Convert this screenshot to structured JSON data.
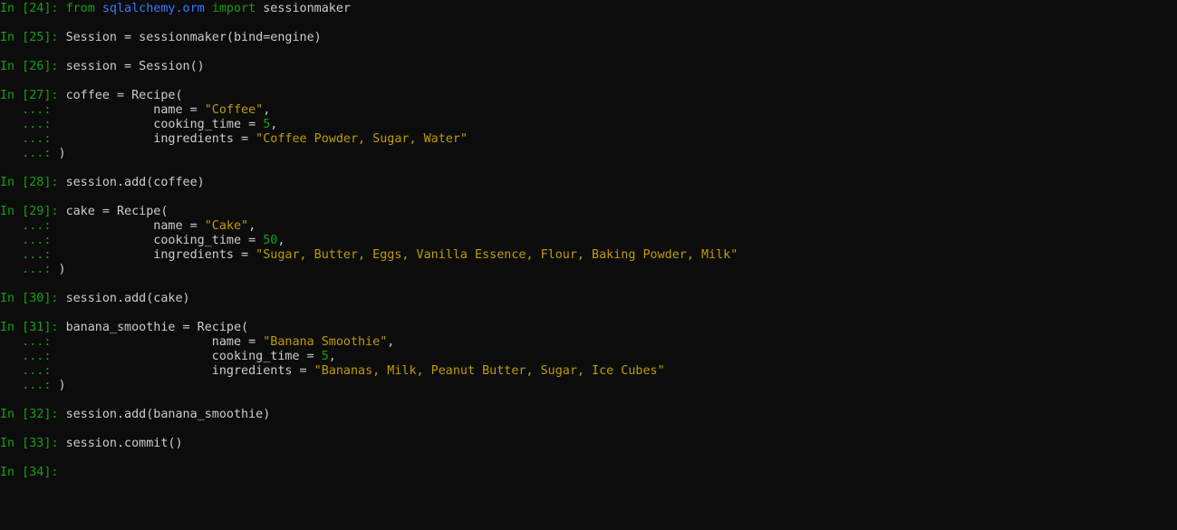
{
  "cells": [
    {
      "prompt": "In [24]: ",
      "lines": [
        [
          {
            "t": "kw",
            "v": "from"
          },
          {
            "t": "txt",
            "v": " "
          },
          {
            "t": "mod",
            "v": "sqlalchemy.orm"
          },
          {
            "t": "txt",
            "v": " "
          },
          {
            "t": "kw",
            "v": "import"
          },
          {
            "t": "txt",
            "v": " sessionmaker"
          }
        ]
      ]
    },
    {
      "prompt": "In [25]: ",
      "lines": [
        [
          {
            "t": "txt",
            "v": "Session = sessionmaker(bind=engine)"
          }
        ]
      ]
    },
    {
      "prompt": "In [26]: ",
      "lines": [
        [
          {
            "t": "txt",
            "v": "session = Session()"
          }
        ]
      ]
    },
    {
      "prompt": "In [27]: ",
      "lines": [
        [
          {
            "t": "txt",
            "v": "coffee = Recipe("
          }
        ],
        [
          {
            "t": "txt",
            "v": "             name = "
          },
          {
            "t": "str",
            "v": "\"Coffee\""
          },
          {
            "t": "txt",
            "v": ","
          }
        ],
        [
          {
            "t": "txt",
            "v": "             cooking_time = "
          },
          {
            "t": "num",
            "v": "5"
          },
          {
            "t": "txt",
            "v": ","
          }
        ],
        [
          {
            "t": "txt",
            "v": "             ingredients = "
          },
          {
            "t": "str",
            "v": "\"Coffee Powder, Sugar, Water\""
          }
        ],
        [
          {
            "t": "txt",
            "v": ")"
          }
        ]
      ]
    },
    {
      "prompt": "In [28]: ",
      "lines": [
        [
          {
            "t": "txt",
            "v": "session.add(coffee)"
          }
        ]
      ]
    },
    {
      "prompt": "In [29]: ",
      "lines": [
        [
          {
            "t": "txt",
            "v": "cake = Recipe("
          }
        ],
        [
          {
            "t": "txt",
            "v": "             name = "
          },
          {
            "t": "str",
            "v": "\"Cake\""
          },
          {
            "t": "txt",
            "v": ","
          }
        ],
        [
          {
            "t": "txt",
            "v": "             cooking_time = "
          },
          {
            "t": "num",
            "v": "50"
          },
          {
            "t": "txt",
            "v": ","
          }
        ],
        [
          {
            "t": "txt",
            "v": "             ingredients = "
          },
          {
            "t": "str",
            "v": "\"Sugar, Butter, Eggs, Vanilla Essence, Flour, Baking Powder, Milk\""
          }
        ],
        [
          {
            "t": "txt",
            "v": ")"
          }
        ]
      ]
    },
    {
      "prompt": "In [30]: ",
      "lines": [
        [
          {
            "t": "txt",
            "v": "session.add(cake)"
          }
        ]
      ]
    },
    {
      "prompt": "In [31]: ",
      "lines": [
        [
          {
            "t": "txt",
            "v": "banana_smoothie = Recipe("
          }
        ],
        [
          {
            "t": "txt",
            "v": "                     name = "
          },
          {
            "t": "str",
            "v": "\"Banana Smoothie\""
          },
          {
            "t": "txt",
            "v": ","
          }
        ],
        [
          {
            "t": "txt",
            "v": "                     cooking_time = "
          },
          {
            "t": "num",
            "v": "5"
          },
          {
            "t": "txt",
            "v": ","
          }
        ],
        [
          {
            "t": "txt",
            "v": "                     ingredients = "
          },
          {
            "t": "str",
            "v": "\"Bananas, Milk, Peanut Butter, Sugar, Ice Cubes\""
          }
        ],
        [
          {
            "t": "txt",
            "v": ")"
          }
        ]
      ]
    },
    {
      "prompt": "In [32]: ",
      "lines": [
        [
          {
            "t": "txt",
            "v": "session.add(banana_smoothie)"
          }
        ]
      ]
    },
    {
      "prompt": "In [33]: ",
      "lines": [
        [
          {
            "t": "txt",
            "v": "session.commit()"
          }
        ]
      ]
    },
    {
      "prompt": "In [34]: ",
      "lines": [
        []
      ]
    }
  ],
  "continuation_prompt": "   ...: ",
  "colors": {
    "background": "#0c0c0c",
    "text": "#cccccc",
    "prompt": "#13a10e",
    "keyword": "#13a10e",
    "module": "#3b78ff",
    "string": "#c19c00",
    "number": "#13a10e"
  }
}
